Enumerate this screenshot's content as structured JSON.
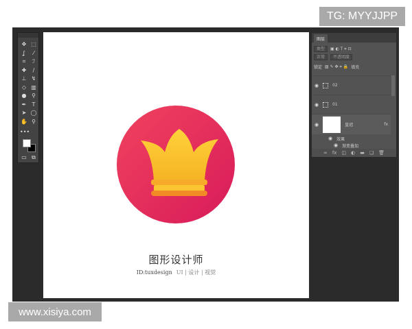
{
  "watermarks": {
    "top": "TG: MYYJJPP",
    "bottom": "www.xisiya.com"
  },
  "toolbar": {
    "tools": [
      "move-icon",
      "marquee-icon",
      "lasso-icon",
      "magic-wand-icon",
      "crop-icon",
      "eyedropper-icon",
      "healing-icon",
      "brush-icon",
      "stamp-icon",
      "history-brush-icon",
      "eraser-icon",
      "gradient-icon",
      "blur-icon",
      "dodge-icon",
      "pen-icon",
      "type-icon",
      "path-select-icon",
      "ellipse-icon",
      "hand-icon",
      "zoom-icon"
    ],
    "more": "•••",
    "foreground": "#ffffff",
    "background": "#000000"
  },
  "layers_panel": {
    "tab": "图层",
    "filter": "类型",
    "blend_mode": "正常",
    "opacity_label": "不透明度",
    "lock_label": "锁定",
    "fill_label": "填充",
    "layers": [
      {
        "name": "02"
      },
      {
        "name": "01"
      },
      {
        "name": "皇冠",
        "fx": "fx"
      }
    ],
    "effects_label": "效果",
    "effect": "渐变叠加"
  },
  "artwork": {
    "circle_colors": [
      "#f0435e",
      "#d81b5a"
    ],
    "crown_colors": [
      "#ffd23a",
      "#f5a623"
    ],
    "title": "图形设计师",
    "id": "ID:tuxdesign",
    "tags": "UI | 设计 | 视觉"
  }
}
